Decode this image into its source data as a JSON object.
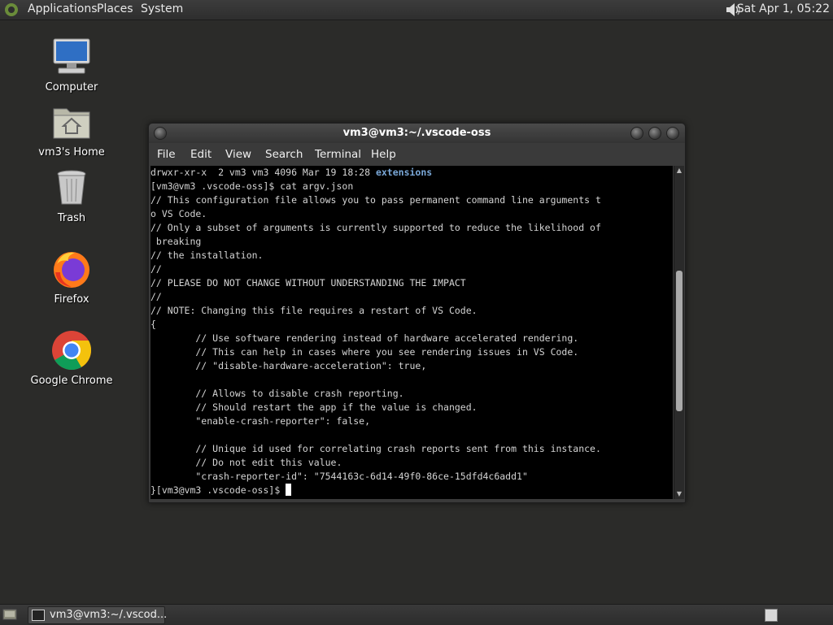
{
  "top_panel": {
    "menus": [
      "Applications",
      "Places",
      "System"
    ],
    "clock": "Sat Apr  1, 05:22",
    "volume_icon": "speaker-icon"
  },
  "desktop_icons": [
    {
      "label": "Computer",
      "icon": "computer-icon"
    },
    {
      "label": "vm3's Home",
      "icon": "home-folder-icon"
    },
    {
      "label": "Trash",
      "icon": "trash-icon"
    },
    {
      "label": "Firefox",
      "icon": "firefox-icon"
    },
    {
      "label": "Google Chrome",
      "icon": "chrome-icon"
    }
  ],
  "terminal": {
    "title": "vm3@vm3:~/.vscode-oss",
    "menu": [
      "File",
      "Edit",
      "View",
      "Search",
      "Terminal",
      "Help"
    ],
    "lines": [
      {
        "text": "drwxr-xr-x  2 vm3 vm3 4096 Mar 19 18:28 ",
        "dir": "extensions"
      },
      {
        "text": "[vm3@vm3 .vscode-oss]$ cat argv.json"
      },
      {
        "text": "// This configuration file allows you to pass permanent command line arguments t"
      },
      {
        "text": "o VS Code."
      },
      {
        "text": "// Only a subset of arguments is currently supported to reduce the likelihood of"
      },
      {
        "text": " breaking"
      },
      {
        "text": "// the installation."
      },
      {
        "text": "//"
      },
      {
        "text": "// PLEASE DO NOT CHANGE WITHOUT UNDERSTANDING THE IMPACT"
      },
      {
        "text": "//"
      },
      {
        "text": "// NOTE: Changing this file requires a restart of VS Code."
      },
      {
        "text": "{"
      },
      {
        "text": "        // Use software rendering instead of hardware accelerated rendering."
      },
      {
        "text": "        // This can help in cases where you see rendering issues in VS Code."
      },
      {
        "text": "        // \"disable-hardware-acceleration\": true,"
      },
      {
        "text": ""
      },
      {
        "text": "        // Allows to disable crash reporting."
      },
      {
        "text": "        // Should restart the app if the value is changed."
      },
      {
        "text": "        \"enable-crash-reporter\": false,"
      },
      {
        "text": ""
      },
      {
        "text": "        // Unique id used for correlating crash reports sent from this instance."
      },
      {
        "text": "        // Do not edit this value."
      },
      {
        "text": "        \"crash-reporter-id\": \"7544163c-6d14-49f0-86ce-15dfd4c6add1\""
      },
      {
        "text": "}[vm3@vm3 .vscode-oss]$ ",
        "cursor": true
      }
    ],
    "scroll_position": 0.55,
    "scroll_visible_fraction": 0.45
  },
  "taskbar": {
    "task_label": "vm3@vm3:~/.vscod...",
    "show_desktop_icon": "show-desktop-icon",
    "workspace_icon": "workspace-switcher-icon"
  }
}
